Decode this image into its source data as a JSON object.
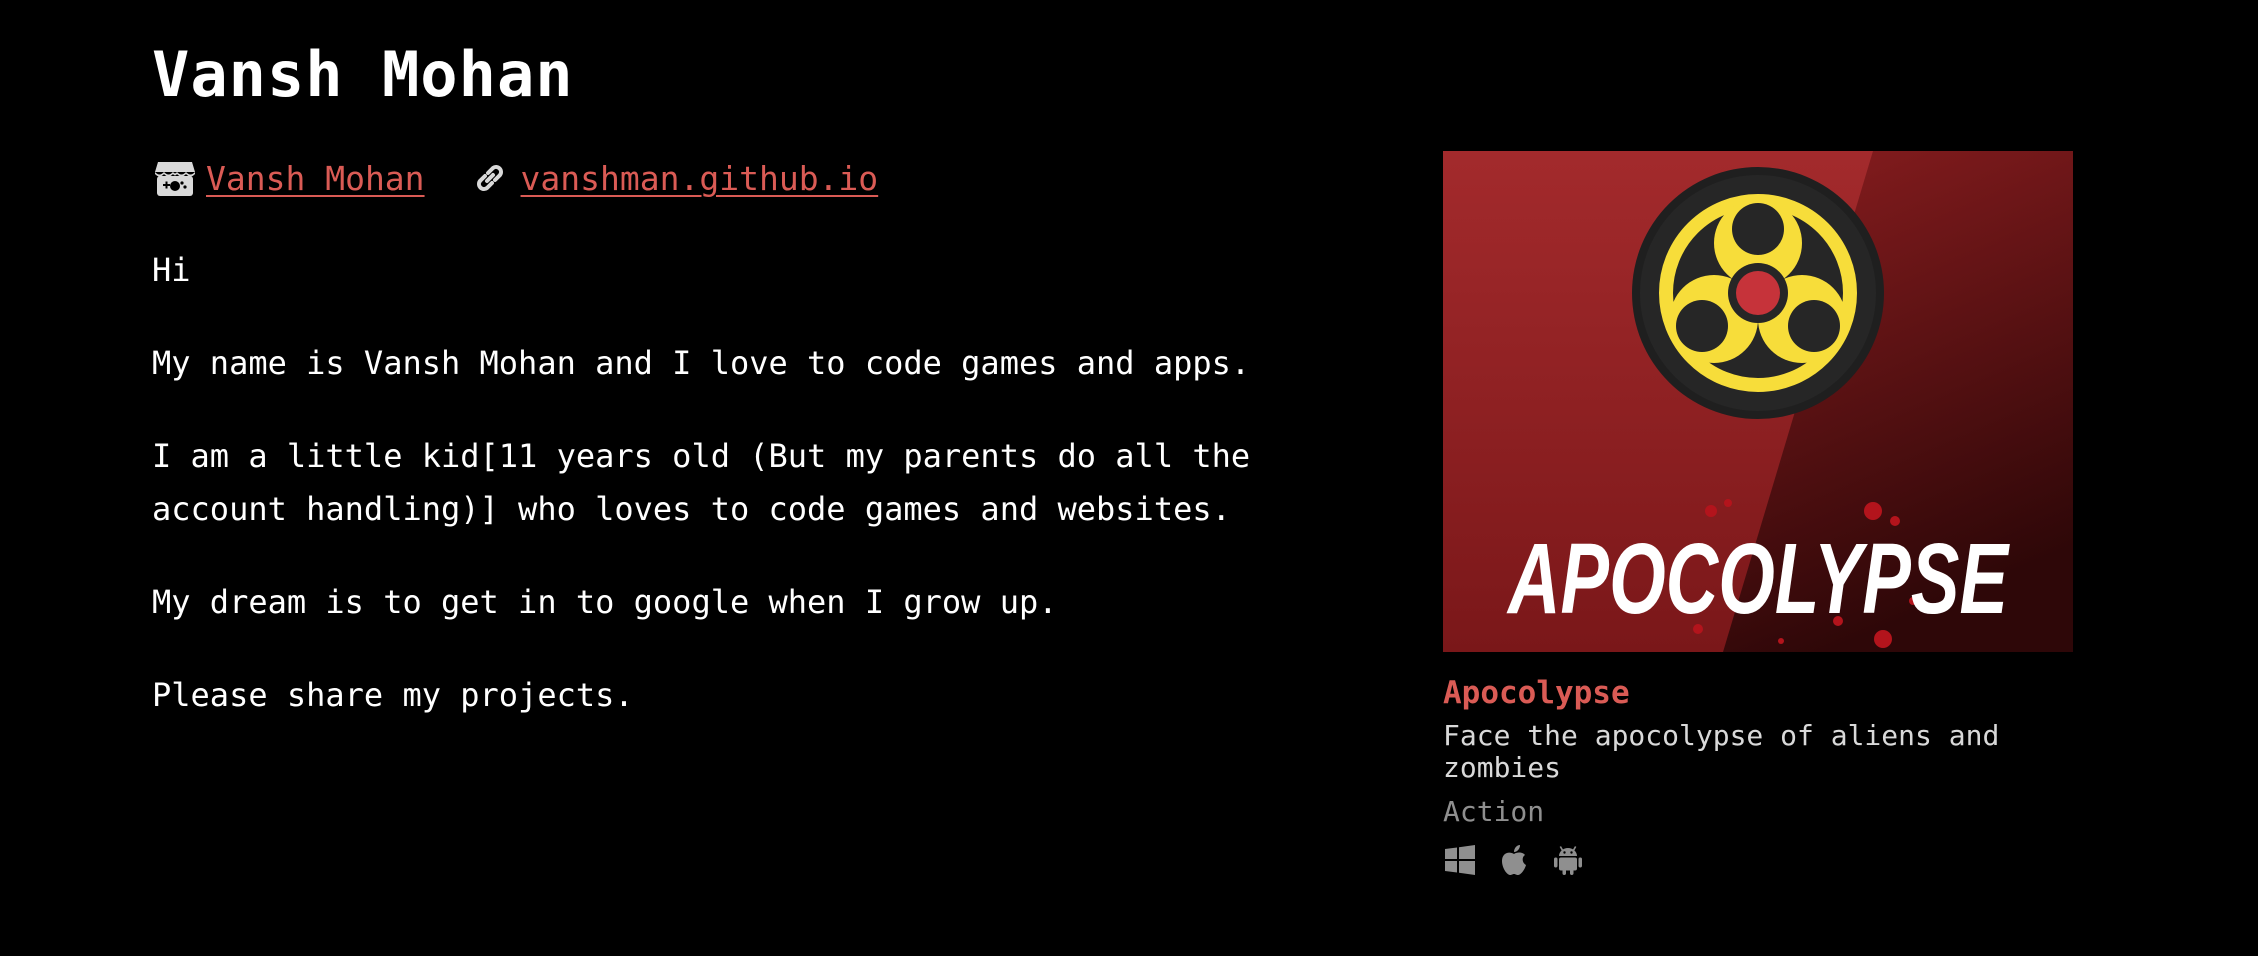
{
  "profile": {
    "name": "Vansh Mohan",
    "itch_link_label": "Vansh Mohan",
    "website_link_label": "vanshman.github.io",
    "bio": [
      "Hi",
      "My name is Vansh Mohan and I love to code games and apps.",
      "I am a little kid[11 years old (But my parents do all the account handling)] who loves to code games and websites.",
      "My dream is to get in to google when I grow up.",
      "Please share my projects."
    ]
  },
  "game": {
    "title": "Apocolypse",
    "thumbnail_text": "APOCOLYPSE",
    "description": "Face the apocolypse of aliens and zombies",
    "genre": "Action",
    "platforms": [
      "windows-icon",
      "apple-icon",
      "android-icon"
    ]
  },
  "colors": {
    "background": "#000000",
    "link": "#da5b55",
    "text": "#ffffff",
    "muted": "#8f8f8f",
    "thumbnail_red": "#9e2a2b",
    "biohazard_yellow": "#f7dd3a"
  },
  "icons": {
    "itch": "itch-io-icon",
    "website": "link-icon"
  }
}
